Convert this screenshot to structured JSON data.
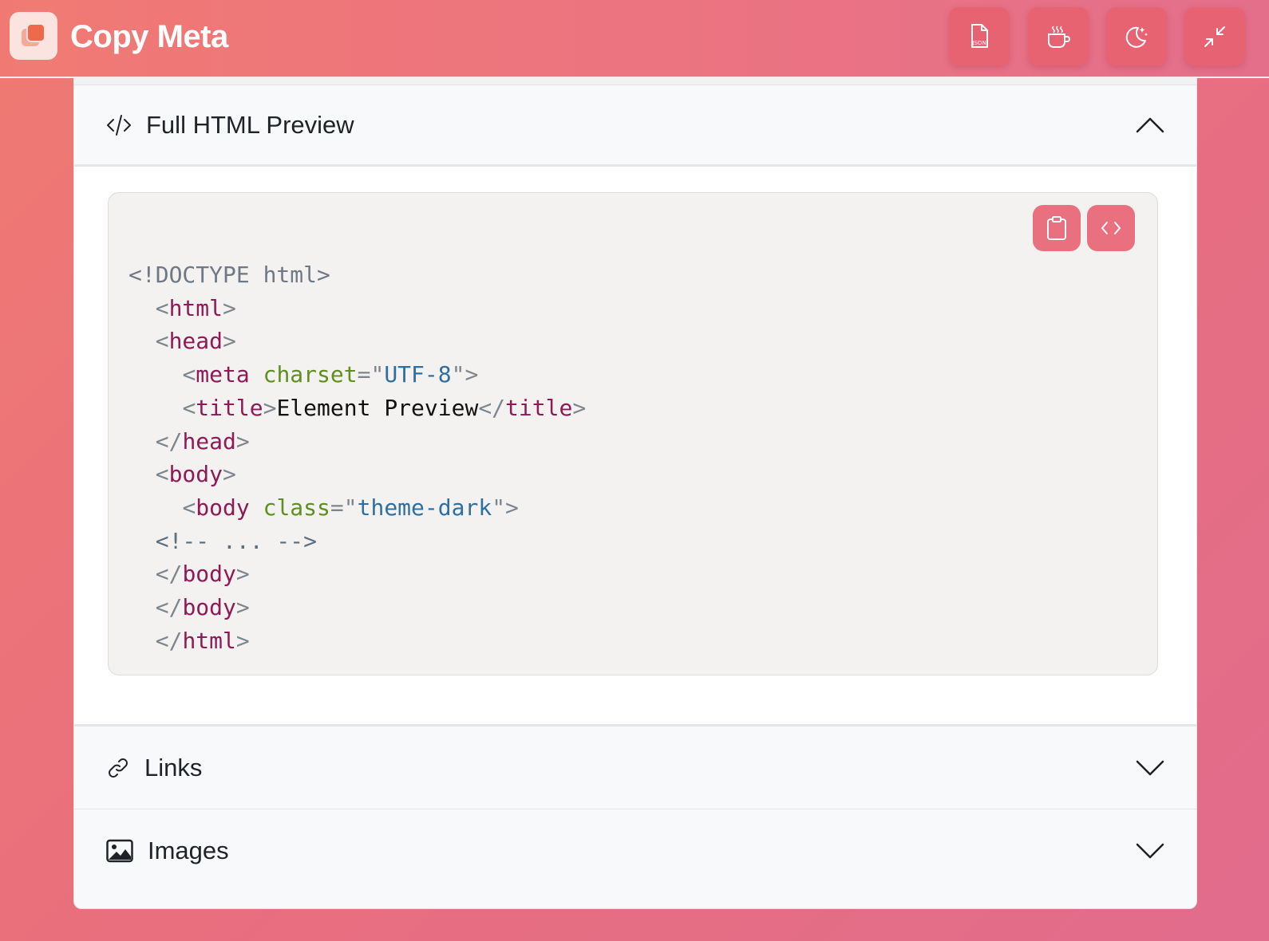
{
  "app": {
    "title": "Copy Meta",
    "logo_icon": "stacked-squares-icon"
  },
  "toolbar": {
    "buttons": [
      {
        "name": "json-export-button",
        "icon": "json-file-icon",
        "icon_text": "JSON"
      },
      {
        "name": "coffee-button",
        "icon": "coffee-cup-icon"
      },
      {
        "name": "dark-mode-button",
        "icon": "moon-stars-icon"
      },
      {
        "name": "minimize-button",
        "icon": "collapse-arrows-icon"
      }
    ]
  },
  "sections": {
    "full_html": {
      "title": "Full HTML Preview",
      "icon": "code-slash-icon",
      "expanded": true,
      "actions": [
        {
          "name": "copy-code-button",
          "icon": "clipboard-icon"
        },
        {
          "name": "view-source-button",
          "icon": "code-brackets-icon"
        }
      ],
      "code_lines": [
        "<!DOCTYPE html>",
        "  <html>",
        "  <head>",
        "    <meta charset=\"UTF-8\">",
        "    <title>Element Preview</title>",
        "  </head>",
        "  <body>",
        "    <body class=\"theme-dark\">",
        "  <!-- ... -->",
        "  </body>",
        "  </body>",
        "  </html>"
      ]
    },
    "links": {
      "title": "Links",
      "icon": "link-icon",
      "expanded": false
    },
    "images": {
      "title": "Images",
      "icon": "image-icon",
      "expanded": false
    }
  },
  "colors": {
    "accent": "#e9707f",
    "header_gradient_start": "#f07a73",
    "header_gradient_end": "#e46f8b",
    "code_tag": "#8f1a55",
    "code_attr": "#5f8f1e",
    "code_value": "#2f6ea0"
  }
}
